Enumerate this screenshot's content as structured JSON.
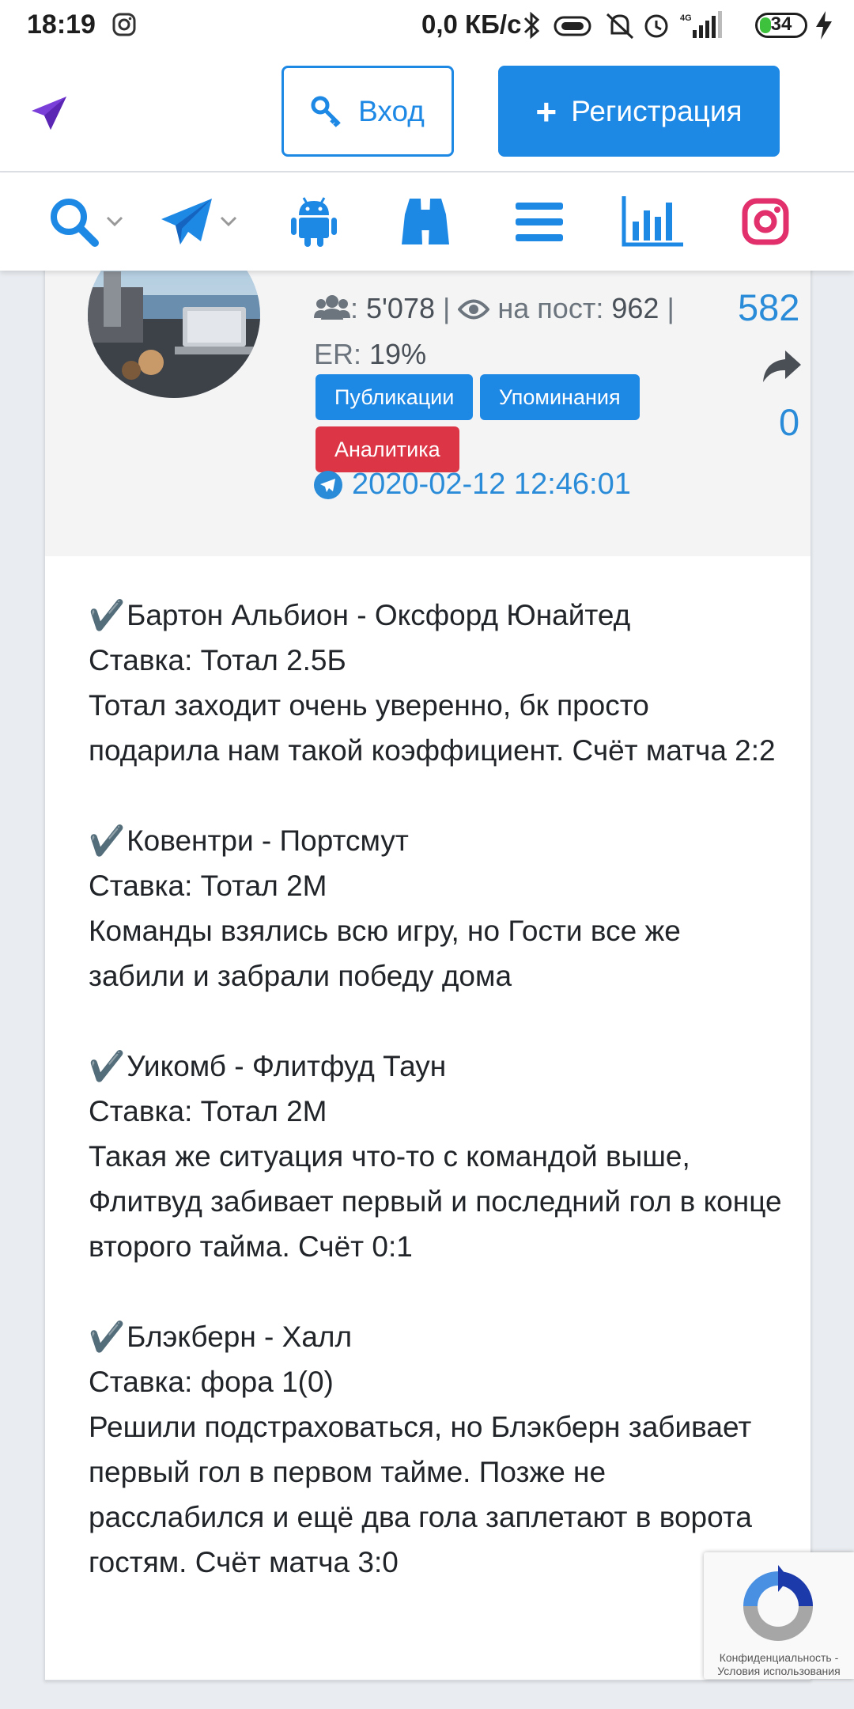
{
  "status_bar": {
    "time": "18:19",
    "network_speed": "0,0 КБ/с",
    "network_type": "4G",
    "battery": "34",
    "battery_level": 0.34
  },
  "header": {
    "login_label": "Вход",
    "register_label": "Регистрация"
  },
  "nav": {
    "icons": [
      "search-icon",
      "telegram-icon",
      "android-icon",
      "binoculars-icon",
      "menu-icon",
      "stats-icon",
      "instagram-icon"
    ]
  },
  "post": {
    "subscribers_value": "5'078",
    "views_label": "на пост:",
    "views_value": "962",
    "sep": "|",
    "er_label": "ER:",
    "er_value": "19%",
    "badges": {
      "publications": "Публикации",
      "mentions": "Упоминания",
      "analytics": "Аналитика"
    },
    "date": "2020-02-12 12:46:01",
    "post_views": "582",
    "shares": "0",
    "blocks": [
      {
        "title": "Бартон Альбион - Оксфорд Юнайтед",
        "bet": "Ставка: Тотал 2.5Б",
        "text": "Тотал заходит очень уверенно, бк просто подарила нам такой коэффициент. Счёт матча 2:2"
      },
      {
        "title": "Ковентри - Портсмут",
        "bet": "Ставка: Тотал 2М",
        "text": "Команды взялись всю игру, но Гости все же забили и забрали победу дома"
      },
      {
        "title": "Уикомб - Флитфуд Таун",
        "bet": "Ставка: Тотал 2М",
        "text": "Такая же ситуация что-то с командой выше, Флитвуд забивает первый и последний гол в конце второго тайма. Счёт 0:1"
      },
      {
        "title": "Блэкберн - Халл",
        "bet": "Ставка: фора 1(0)",
        "text": "Решили подстраховаться, но Блэкберн забивает первый гол в первом тайме. Позже не расслабился и ещё два гола заплетают в ворота гостям. Счёт матча 3:0"
      }
    ]
  },
  "recaptcha": {
    "privacy": "Конфиденциальность -",
    "terms": "Условия использования"
  },
  "colors": {
    "primary": "#1e88e5",
    "danger": "#dc3545",
    "link": "#2a8cd8"
  }
}
